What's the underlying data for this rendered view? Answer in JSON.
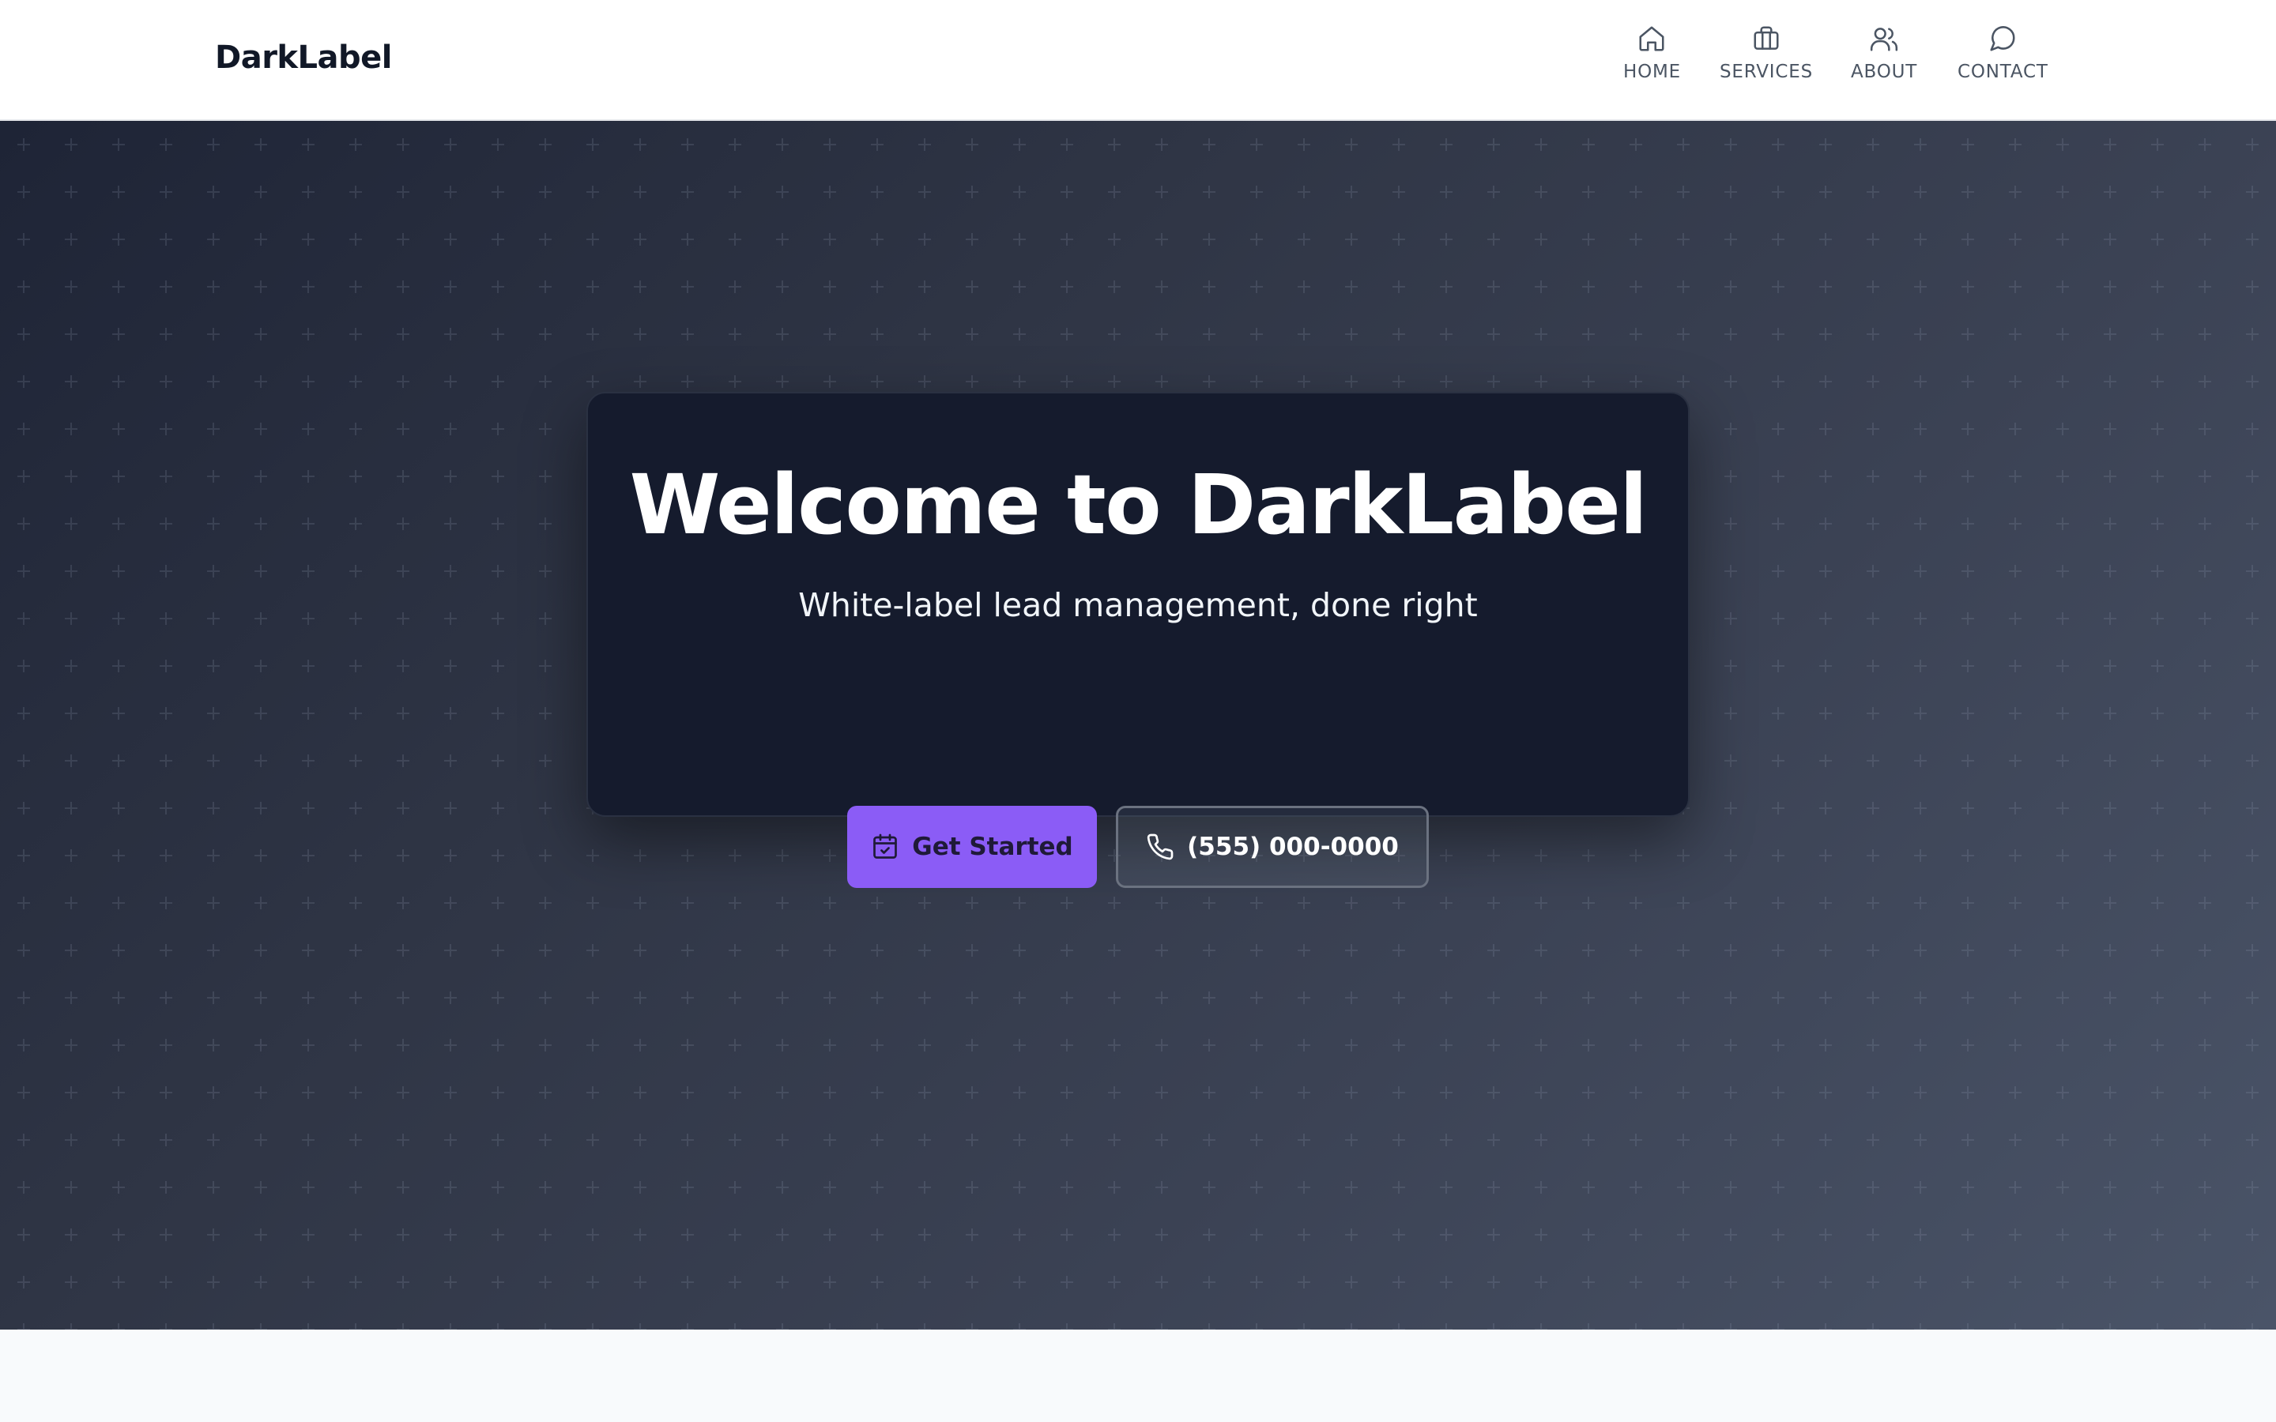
{
  "header": {
    "brand": "DarkLabel",
    "nav": [
      {
        "label": "HOME",
        "icon": "home-icon"
      },
      {
        "label": "SERVICES",
        "icon": "briefcase-icon"
      },
      {
        "label": "ABOUT",
        "icon": "users-icon"
      },
      {
        "label": "CONTACT",
        "icon": "message-circle-icon"
      }
    ]
  },
  "hero": {
    "title": "Welcome to DarkLabel",
    "subtitle": "White-label lead management, done right",
    "primary_button": {
      "label": "Get Started",
      "icon": "calendar-check-icon"
    },
    "secondary_button": {
      "label": "(555) 000-0000",
      "icon": "phone-icon"
    }
  },
  "colors": {
    "accent": "#8b5cf6",
    "card_bg": "#151b2d",
    "header_bg": "#ffffff"
  }
}
